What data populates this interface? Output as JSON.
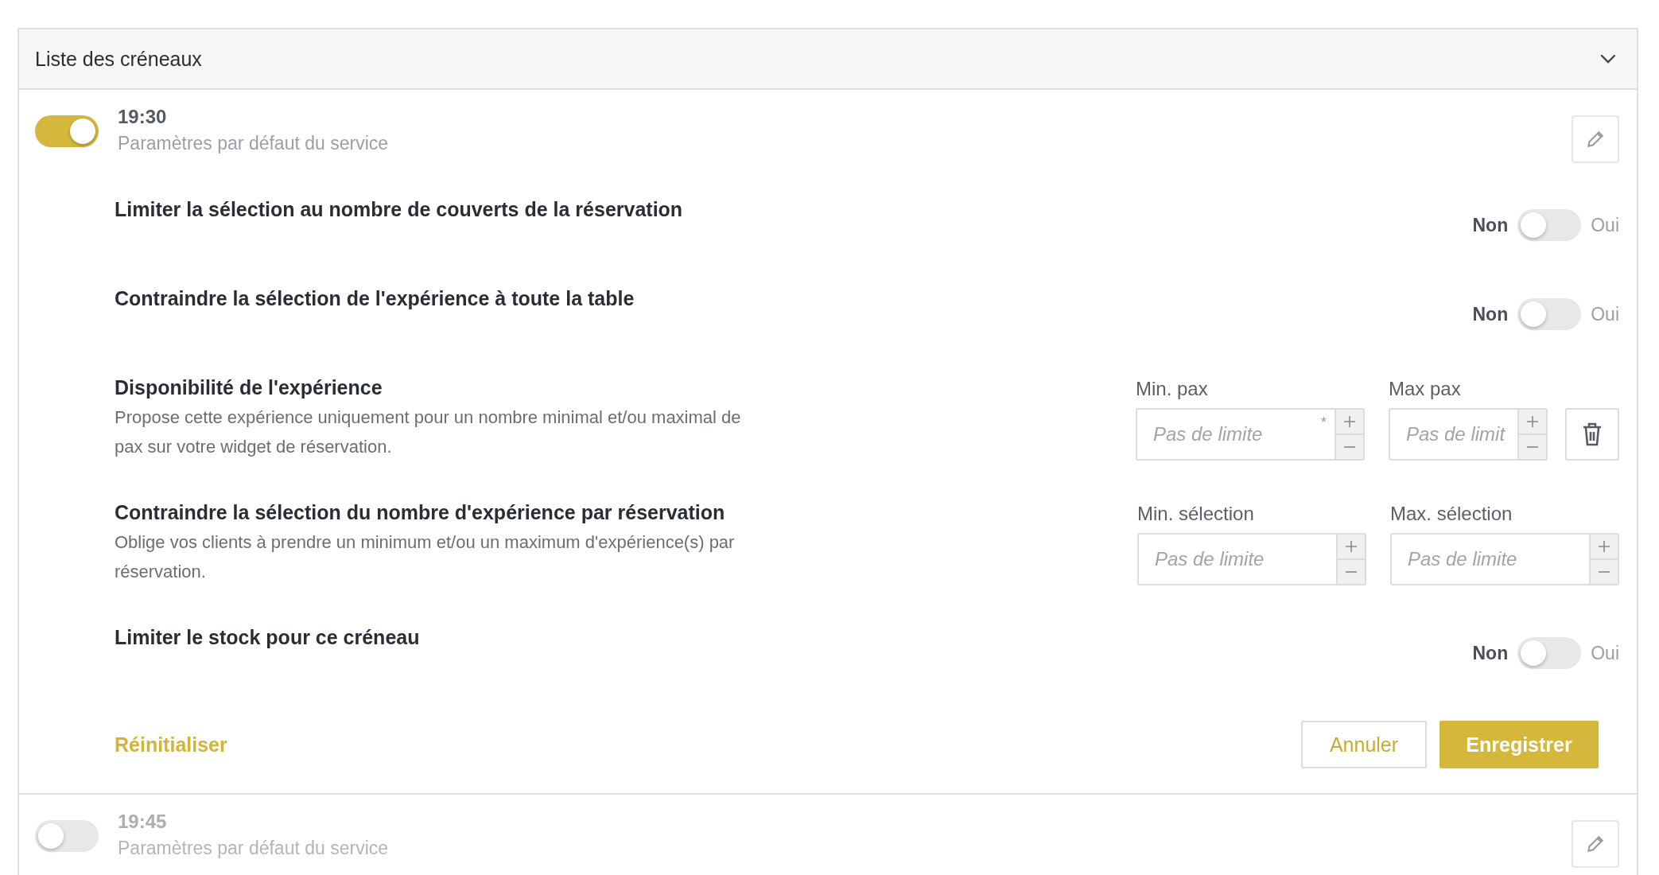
{
  "panel": {
    "title": "Liste des créneaux",
    "expanded": true
  },
  "slots": [
    {
      "time": "19:30",
      "subtitle": "Paramètres par défaut du service",
      "enabled": true,
      "settings": [
        {
          "kind": "toggle",
          "title": "Limiter la sélection au nombre de couverts de la réservation",
          "off_label": "Non",
          "on_label": "Oui",
          "on": false
        },
        {
          "kind": "toggle",
          "title": "Contraindre la sélection de l'expérience à toute la table",
          "off_label": "Non",
          "on_label": "Oui",
          "on": false
        },
        {
          "kind": "range",
          "title": "Disponibilité de l'expérience",
          "description": "Propose cette expérience uniquement pour un nombre minimal et/ou maximal de pax sur votre widget de réservation.",
          "deletable": true,
          "fields": [
            {
              "label": "Min. pax",
              "placeholder": "Pas de limite",
              "marker": "*"
            },
            {
              "label": "Max pax",
              "placeholder": "Pas de limit"
            }
          ]
        },
        {
          "kind": "range",
          "title": "Contraindre la sélection du nombre d'expérience par réservation",
          "description": "Oblige vos clients à prendre un minimum et/ou un maximum d'expérience(s) par réservation.",
          "deletable": false,
          "fields": [
            {
              "label": "Min. sélection",
              "placeholder": "Pas de limite"
            },
            {
              "label": "Max. sélection",
              "placeholder": "Pas de limite"
            }
          ]
        },
        {
          "kind": "toggle",
          "title": "Limiter le stock pour ce créneau",
          "off_label": "Non",
          "on_label": "Oui",
          "on": false
        }
      ],
      "actions": {
        "reset": "Réinitialiser",
        "cancel": "Annuler",
        "save": "Enregistrer"
      }
    },
    {
      "time": "19:45",
      "subtitle": "Paramètres par défaut du service",
      "enabled": false
    }
  ]
}
